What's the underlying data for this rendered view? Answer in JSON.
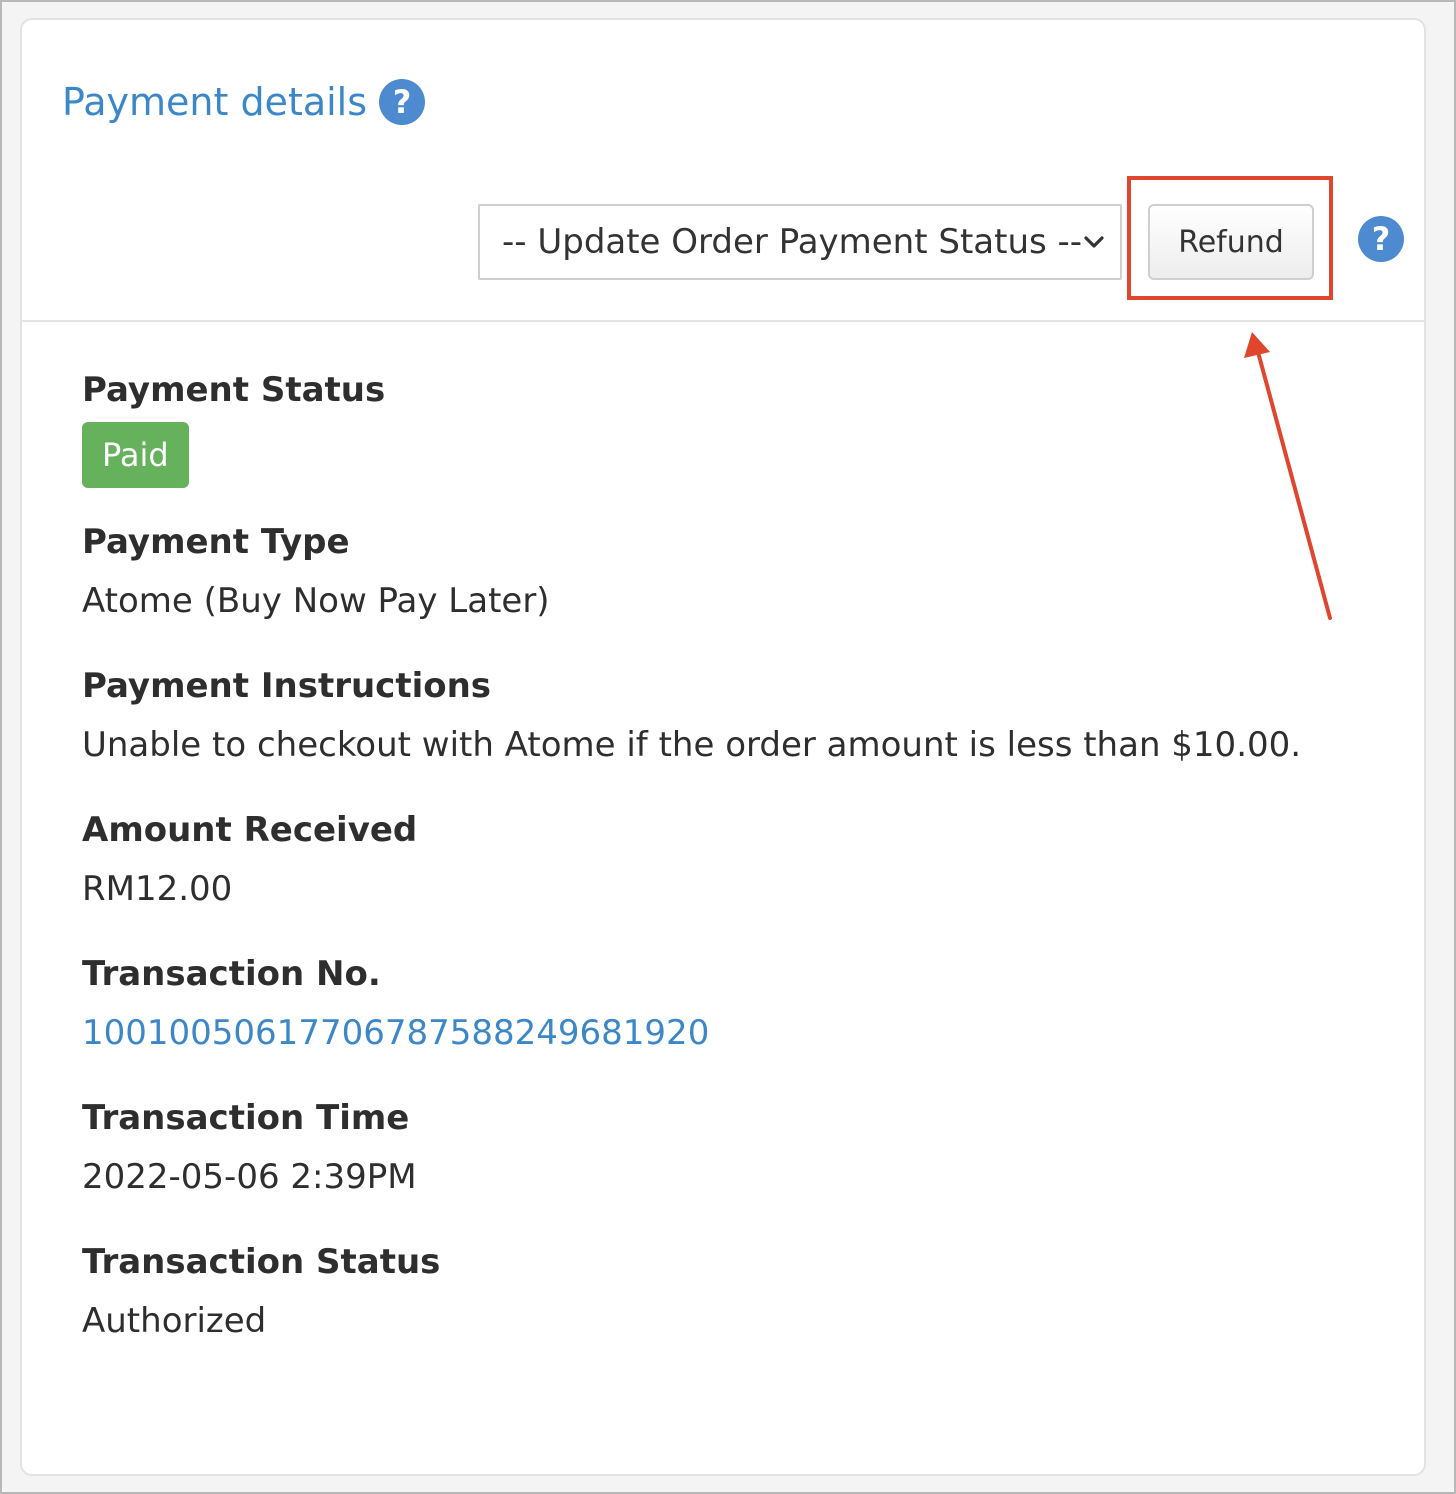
{
  "panel": {
    "title": "Payment details",
    "help_icon": "question-circle-icon"
  },
  "toolbar": {
    "status_select_value": "-- Update Order Payment Status --",
    "refund_label": "Refund",
    "help_icon": "question-circle-icon"
  },
  "details": {
    "payment_status": {
      "label": "Payment Status",
      "value": "Paid"
    },
    "payment_type": {
      "label": "Payment Type",
      "value": "Atome (Buy Now Pay Later)"
    },
    "payment_instructions": {
      "label": "Payment Instructions",
      "value": "Unable to checkout with Atome if the order amount is less than $10.00."
    },
    "amount_received": {
      "label": "Amount Received",
      "value": "RM12.00"
    },
    "transaction_no": {
      "label": "Transaction No.",
      "value": "1001005061770678758824968192​0"
    },
    "transaction_time": {
      "label": "Transaction Time",
      "value": "2022-05-06 2:39PM"
    },
    "transaction_status": {
      "label": "Transaction Status",
      "value": "Authorized"
    }
  },
  "colors": {
    "link": "#3c87c7",
    "paid_badge": "#66b15c",
    "annotation": "#e0462e"
  }
}
